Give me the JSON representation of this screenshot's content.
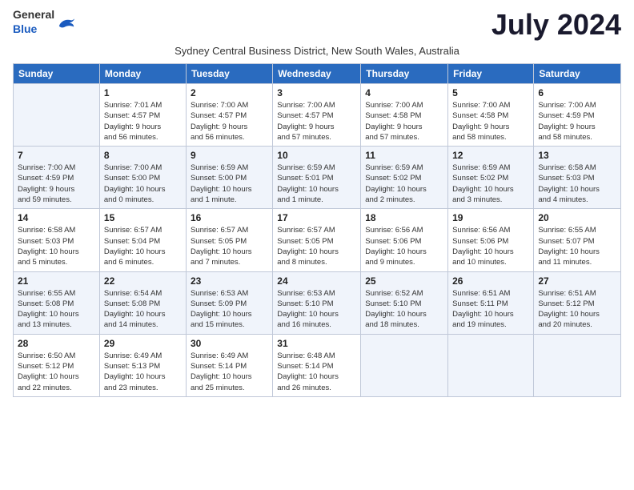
{
  "header": {
    "logo_general": "General",
    "logo_blue": "Blue",
    "month_title": "July 2024",
    "subtitle": "Sydney Central Business District, New South Wales, Australia"
  },
  "calendar": {
    "days_of_week": [
      "Sunday",
      "Monday",
      "Tuesday",
      "Wednesday",
      "Thursday",
      "Friday",
      "Saturday"
    ],
    "weeks": [
      [
        {
          "day": "",
          "detail": ""
        },
        {
          "day": "1",
          "detail": "Sunrise: 7:01 AM\nSunset: 4:57 PM\nDaylight: 9 hours\nand 56 minutes."
        },
        {
          "day": "2",
          "detail": "Sunrise: 7:00 AM\nSunset: 4:57 PM\nDaylight: 9 hours\nand 56 minutes."
        },
        {
          "day": "3",
          "detail": "Sunrise: 7:00 AM\nSunset: 4:57 PM\nDaylight: 9 hours\nand 57 minutes."
        },
        {
          "day": "4",
          "detail": "Sunrise: 7:00 AM\nSunset: 4:58 PM\nDaylight: 9 hours\nand 57 minutes."
        },
        {
          "day": "5",
          "detail": "Sunrise: 7:00 AM\nSunset: 4:58 PM\nDaylight: 9 hours\nand 58 minutes."
        },
        {
          "day": "6",
          "detail": "Sunrise: 7:00 AM\nSunset: 4:59 PM\nDaylight: 9 hours\nand 58 minutes."
        }
      ],
      [
        {
          "day": "7",
          "detail": "Sunrise: 7:00 AM\nSunset: 4:59 PM\nDaylight: 9 hours\nand 59 minutes."
        },
        {
          "day": "8",
          "detail": "Sunrise: 7:00 AM\nSunset: 5:00 PM\nDaylight: 10 hours\nand 0 minutes."
        },
        {
          "day": "9",
          "detail": "Sunrise: 6:59 AM\nSunset: 5:00 PM\nDaylight: 10 hours\nand 1 minute."
        },
        {
          "day": "10",
          "detail": "Sunrise: 6:59 AM\nSunset: 5:01 PM\nDaylight: 10 hours\nand 1 minute."
        },
        {
          "day": "11",
          "detail": "Sunrise: 6:59 AM\nSunset: 5:02 PM\nDaylight: 10 hours\nand 2 minutes."
        },
        {
          "day": "12",
          "detail": "Sunrise: 6:59 AM\nSunset: 5:02 PM\nDaylight: 10 hours\nand 3 minutes."
        },
        {
          "day": "13",
          "detail": "Sunrise: 6:58 AM\nSunset: 5:03 PM\nDaylight: 10 hours\nand 4 minutes."
        }
      ],
      [
        {
          "day": "14",
          "detail": "Sunrise: 6:58 AM\nSunset: 5:03 PM\nDaylight: 10 hours\nand 5 minutes."
        },
        {
          "day": "15",
          "detail": "Sunrise: 6:57 AM\nSunset: 5:04 PM\nDaylight: 10 hours\nand 6 minutes."
        },
        {
          "day": "16",
          "detail": "Sunrise: 6:57 AM\nSunset: 5:05 PM\nDaylight: 10 hours\nand 7 minutes."
        },
        {
          "day": "17",
          "detail": "Sunrise: 6:57 AM\nSunset: 5:05 PM\nDaylight: 10 hours\nand 8 minutes."
        },
        {
          "day": "18",
          "detail": "Sunrise: 6:56 AM\nSunset: 5:06 PM\nDaylight: 10 hours\nand 9 minutes."
        },
        {
          "day": "19",
          "detail": "Sunrise: 6:56 AM\nSunset: 5:06 PM\nDaylight: 10 hours\nand 10 minutes."
        },
        {
          "day": "20",
          "detail": "Sunrise: 6:55 AM\nSunset: 5:07 PM\nDaylight: 10 hours\nand 11 minutes."
        }
      ],
      [
        {
          "day": "21",
          "detail": "Sunrise: 6:55 AM\nSunset: 5:08 PM\nDaylight: 10 hours\nand 13 minutes."
        },
        {
          "day": "22",
          "detail": "Sunrise: 6:54 AM\nSunset: 5:08 PM\nDaylight: 10 hours\nand 14 minutes."
        },
        {
          "day": "23",
          "detail": "Sunrise: 6:53 AM\nSunset: 5:09 PM\nDaylight: 10 hours\nand 15 minutes."
        },
        {
          "day": "24",
          "detail": "Sunrise: 6:53 AM\nSunset: 5:10 PM\nDaylight: 10 hours\nand 16 minutes."
        },
        {
          "day": "25",
          "detail": "Sunrise: 6:52 AM\nSunset: 5:10 PM\nDaylight: 10 hours\nand 18 minutes."
        },
        {
          "day": "26",
          "detail": "Sunrise: 6:51 AM\nSunset: 5:11 PM\nDaylight: 10 hours\nand 19 minutes."
        },
        {
          "day": "27",
          "detail": "Sunrise: 6:51 AM\nSunset: 5:12 PM\nDaylight: 10 hours\nand 20 minutes."
        }
      ],
      [
        {
          "day": "28",
          "detail": "Sunrise: 6:50 AM\nSunset: 5:12 PM\nDaylight: 10 hours\nand 22 minutes."
        },
        {
          "day": "29",
          "detail": "Sunrise: 6:49 AM\nSunset: 5:13 PM\nDaylight: 10 hours\nand 23 minutes."
        },
        {
          "day": "30",
          "detail": "Sunrise: 6:49 AM\nSunset: 5:14 PM\nDaylight: 10 hours\nand 25 minutes."
        },
        {
          "day": "31",
          "detail": "Sunrise: 6:48 AM\nSunset: 5:14 PM\nDaylight: 10 hours\nand 26 minutes."
        },
        {
          "day": "",
          "detail": ""
        },
        {
          "day": "",
          "detail": ""
        },
        {
          "day": "",
          "detail": ""
        }
      ]
    ]
  }
}
